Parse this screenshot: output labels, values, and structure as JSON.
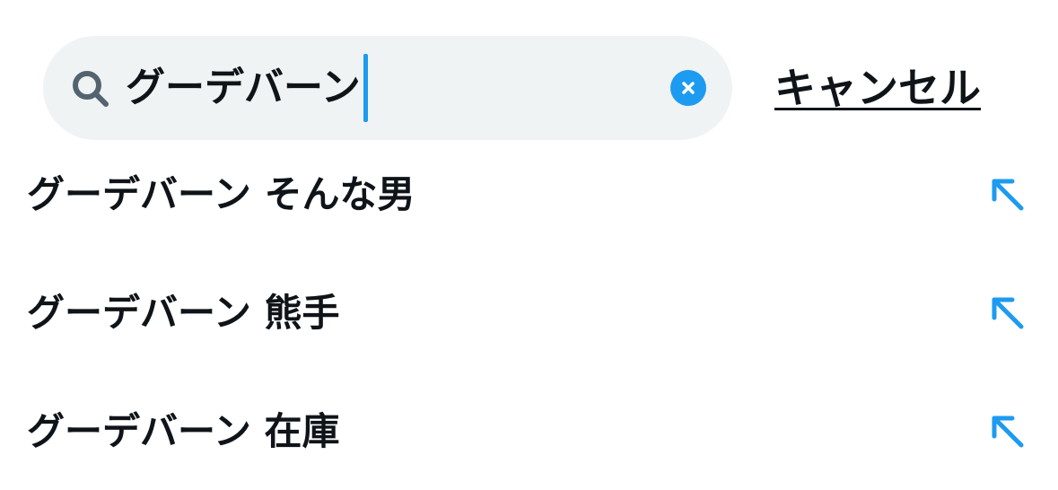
{
  "search": {
    "query": "グーデバーン",
    "icon": "search-icon",
    "clear_icon": "close-icon"
  },
  "cancel_label": "キャンセル",
  "suggestions": [
    {
      "label": "グーデバーン そんな男",
      "icon": "arrow-up-left-icon"
    },
    {
      "label": "グーデバーン 熊手",
      "icon": "arrow-up-left-icon"
    },
    {
      "label": "グーデバーン 在庫",
      "icon": "arrow-up-left-icon"
    }
  ],
  "colors": {
    "accent": "#1d9bf0",
    "search_bg": "#eff3f4",
    "text": "#0f1419",
    "icon_gray": "#536471"
  }
}
